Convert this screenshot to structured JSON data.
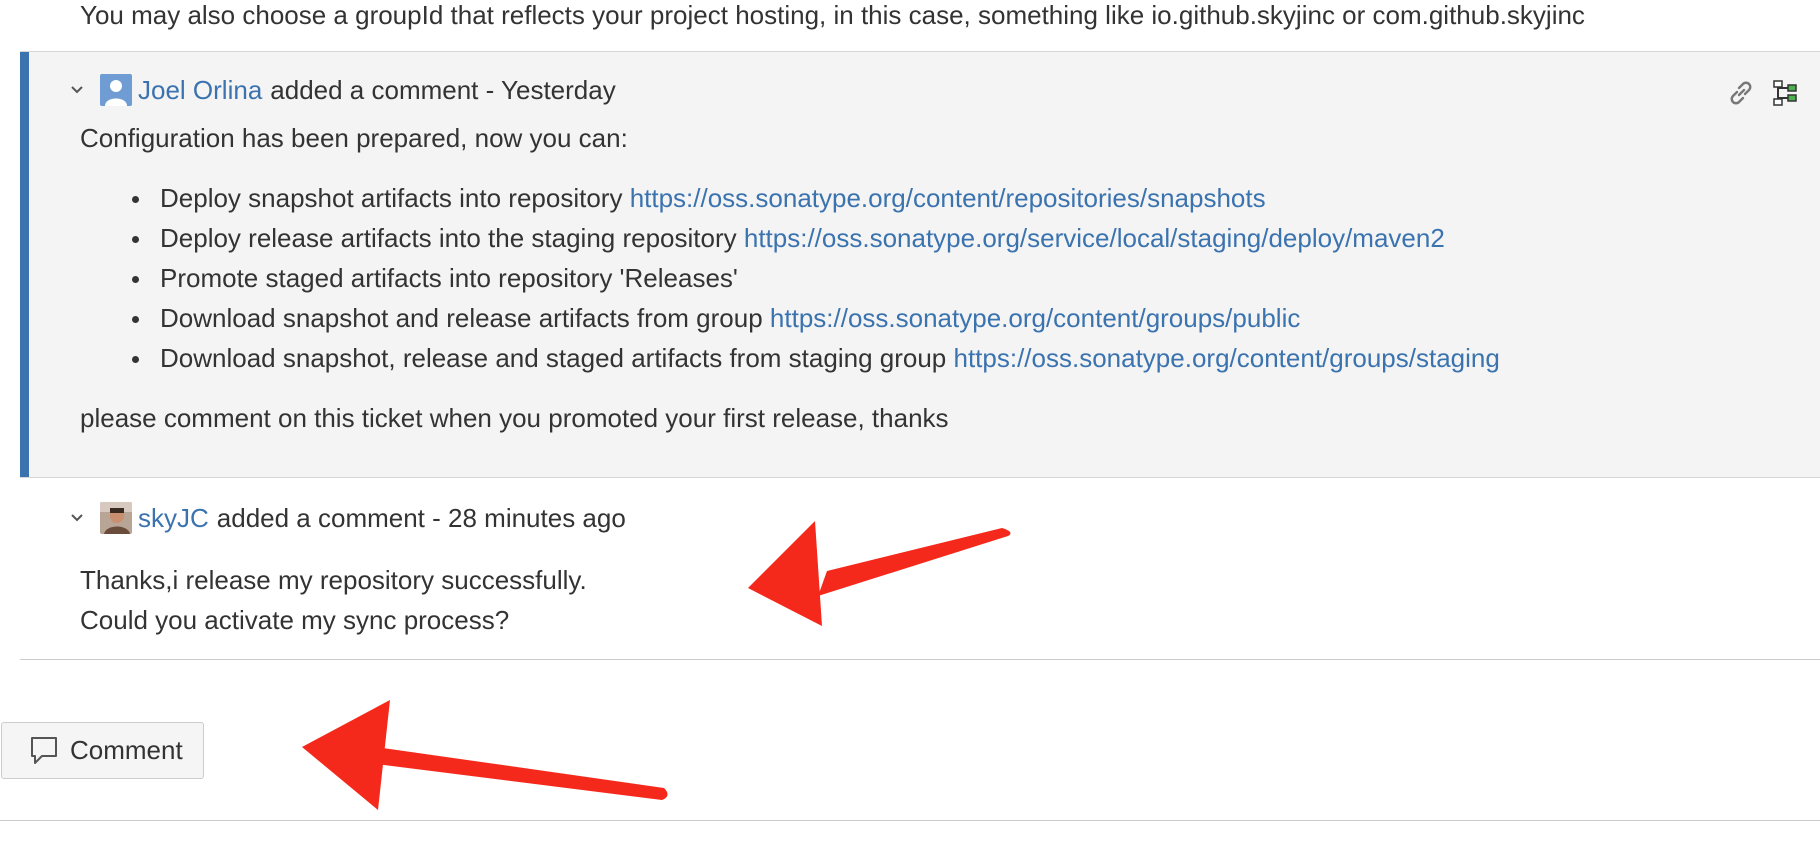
{
  "intro_text": "You may also choose a groupId that reflects your project hosting, in this case, something like io.github.skyjinc or com.github.skyjinc",
  "comment1": {
    "author": "Joel Orlina",
    "action": "added a comment - Yesterday",
    "body_intro": "Configuration has been prepared, now you can:",
    "items": [
      {
        "text": "Deploy snapshot artifacts into repository ",
        "link": "https://oss.sonatype.org/content/repositories/snapshots"
      },
      {
        "text": "Deploy release artifacts into the staging repository ",
        "link": "https://oss.sonatype.org/service/local/staging/deploy/maven2"
      },
      {
        "text": "Promote staged artifacts into repository 'Releases'",
        "link": ""
      },
      {
        "text": "Download snapshot and release artifacts from group ",
        "link": "https://oss.sonatype.org/content/groups/public"
      },
      {
        "text": "Download snapshot, release and staged artifacts from staging group ",
        "link": "https://oss.sonatype.org/content/groups/staging"
      }
    ],
    "closing": "please comment on this ticket when you promoted your first release, thanks"
  },
  "comment2": {
    "author": "skyJC",
    "action": "added a comment - 28 minutes ago",
    "line1": "Thanks,i release my repository successfully.",
    "line2": "Could you activate my sync process?"
  },
  "comment_button_label": "Comment",
  "colors": {
    "accent": "#3b73af",
    "link": "#3b73af",
    "annotation_arrow": "#f5291b"
  }
}
